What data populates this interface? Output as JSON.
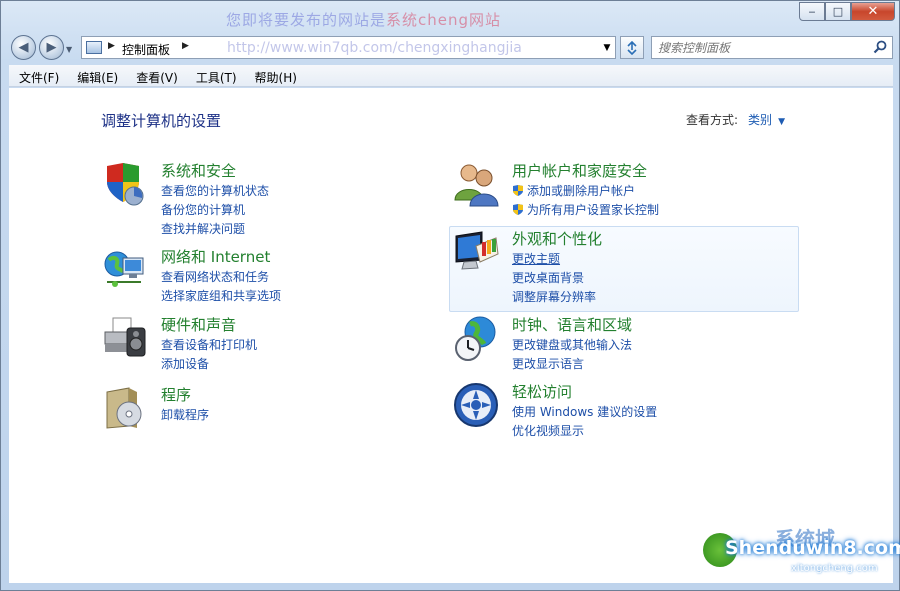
{
  "titlebar": {
    "watermark_prefix": "您即将要发布的网站是",
    "watermark_highlight": "系统cheng网站"
  },
  "caption": {
    "minimize": "‒",
    "maximize": "□",
    "close": "✕"
  },
  "nav": {
    "back": "◀",
    "forward": "▶",
    "address_path": "控制面板",
    "address_arrow": "▶",
    "address_watermark": "http://www.win7qb.com/chengxinghangjia",
    "search_placeholder": "搜索控制面板"
  },
  "menu": [
    "文件(F)",
    "编辑(E)",
    "查看(V)",
    "工具(T)",
    "帮助(H)"
  ],
  "page_title": "调整计算机的设置",
  "view_by": {
    "label": "查看方式:",
    "value": "类别"
  },
  "categories": {
    "system": {
      "title": "系统和安全",
      "links": [
        "查看您的计算机状态",
        "备份您的计算机",
        "查找并解决问题"
      ]
    },
    "network": {
      "title": "网络和 Internet",
      "links": [
        "查看网络状态和任务",
        "选择家庭组和共享选项"
      ]
    },
    "hardware": {
      "title": "硬件和声音",
      "links": [
        "查看设备和打印机",
        "添加设备"
      ]
    },
    "programs": {
      "title": "程序",
      "links": [
        "卸载程序"
      ]
    },
    "users": {
      "title": "用户帐户和家庭安全",
      "links": [
        "添加或删除用户帐户",
        "为所有用户设置家长控制"
      ]
    },
    "appearance": {
      "title": "外观和个性化",
      "links": [
        "更改主题",
        "更改桌面背景",
        "调整屏幕分辨率"
      ]
    },
    "clock": {
      "title": "时钟、语言和区域",
      "links": [
        "更改键盘或其他输入法",
        "更改显示语言"
      ]
    },
    "ease": {
      "title": "轻松访问",
      "links": [
        "使用 Windows 建议的设置",
        "优化视频显示"
      ]
    }
  },
  "watermark": {
    "site": "Shenduwin8.com",
    "sub": "xitongcheng.com",
    "brand": "系统城"
  }
}
